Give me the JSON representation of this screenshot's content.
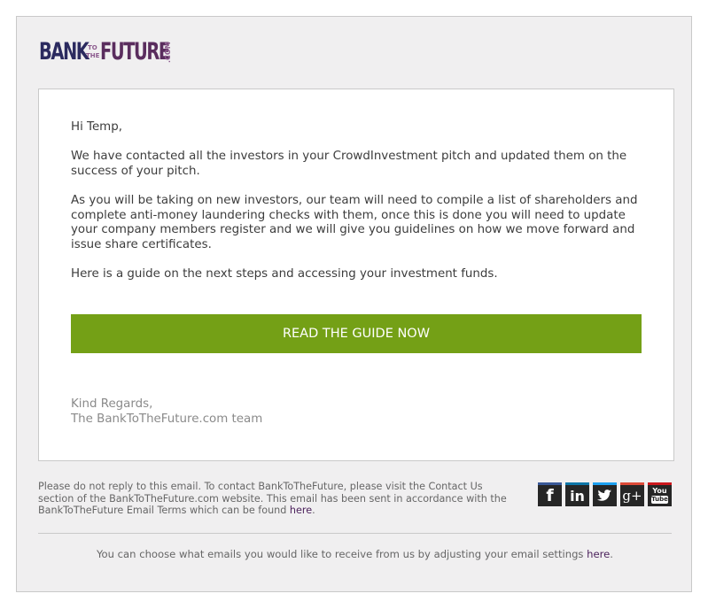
{
  "logo": {
    "bank": "BANK",
    "to": "TO",
    "the": "THE",
    "future": "FUTURE",
    "com": ".COM"
  },
  "email": {
    "greeting": "Hi Temp,",
    "paragraph1": "We have contacted all the investors in your CrowdInvestment pitch and updated them on the success of your pitch.",
    "paragraph2": "As you will be taking on new investors, our team will need to compile a list of shareholders and complete anti-money laundering checks with them, once this is done you will need to update your company members register and we will give you guidelines on how we move forward and issue share certificates.",
    "paragraph3": "Here is a guide on the next steps and accessing your investment funds.",
    "cta_label": "READ THE GUIDE NOW",
    "regards_line1": "Kind Regards,",
    "regards_line2": "The BankToTheFuture.com team"
  },
  "footer": {
    "disclaimer_text": "Please do not reply to this email. To contact BankToTheFuture, please visit the Contact Us section of the BankToTheFuture.com website. This email has been sent in accordance with the BankToTheFuture Email Terms which can be found ",
    "disclaimer_link": "here",
    "disclaimer_end": ".",
    "settings_text": "You can choose what emails you would like to receive from us by adjusting your email settings ",
    "settings_link": "here",
    "settings_end": "."
  },
  "social": {
    "facebook": "f",
    "linkedin": "in",
    "twitter_icon": "twitter-bird",
    "googleplus": "g+",
    "youtube_top": "You",
    "youtube_bottom": "Tube"
  },
  "colors": {
    "cta": "#74a016",
    "logo_navy": "#2b2a5f",
    "logo_purple": "#5a2d5e",
    "link": "#4a1f5a",
    "facebook_bar": "#3b5998",
    "linkedin_bar": "#0e76a8",
    "twitter_bar": "#1da1f2",
    "googleplus_bar": "#dd4b39",
    "youtube_bar": "#cc181e"
  }
}
